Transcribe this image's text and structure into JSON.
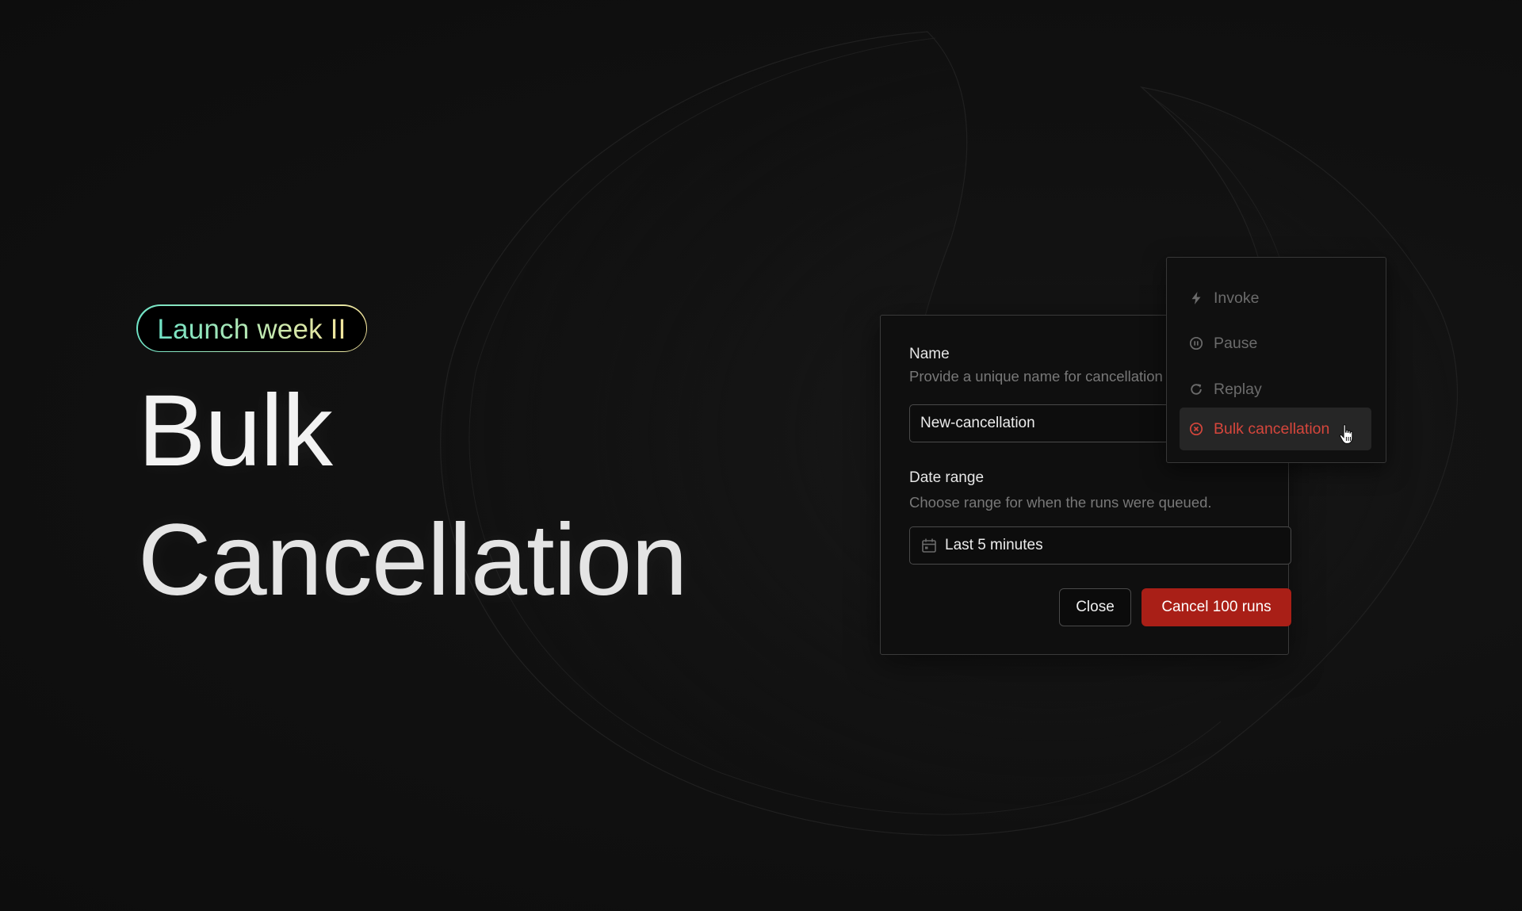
{
  "badge": {
    "label": "Launch week II",
    "gradient_start": "#6fe3c6",
    "gradient_end": "#f2e39b"
  },
  "hero": {
    "line1": "Bulk",
    "line2": "Cancellation"
  },
  "dialog": {
    "name_label": "Name",
    "name_description": "Provide a unique name for cancellation",
    "name_value": "New-cancellation",
    "date_label": "Date range",
    "date_description": "Choose range for when the runs were queued.",
    "date_value": "Last 5 minutes",
    "close_label": "Close",
    "submit_label": "Cancel 100 runs",
    "submit_color": "#a91f17"
  },
  "menu": {
    "items": [
      {
        "label": "Invoke",
        "icon": "bolt-icon"
      },
      {
        "label": "Pause",
        "icon": "pause-circle-icon"
      },
      {
        "label": "Replay",
        "icon": "replay-icon"
      },
      {
        "label": "Bulk cancellation",
        "icon": "x-circle-icon",
        "active": true
      }
    ],
    "active_color": "#d5463c"
  }
}
